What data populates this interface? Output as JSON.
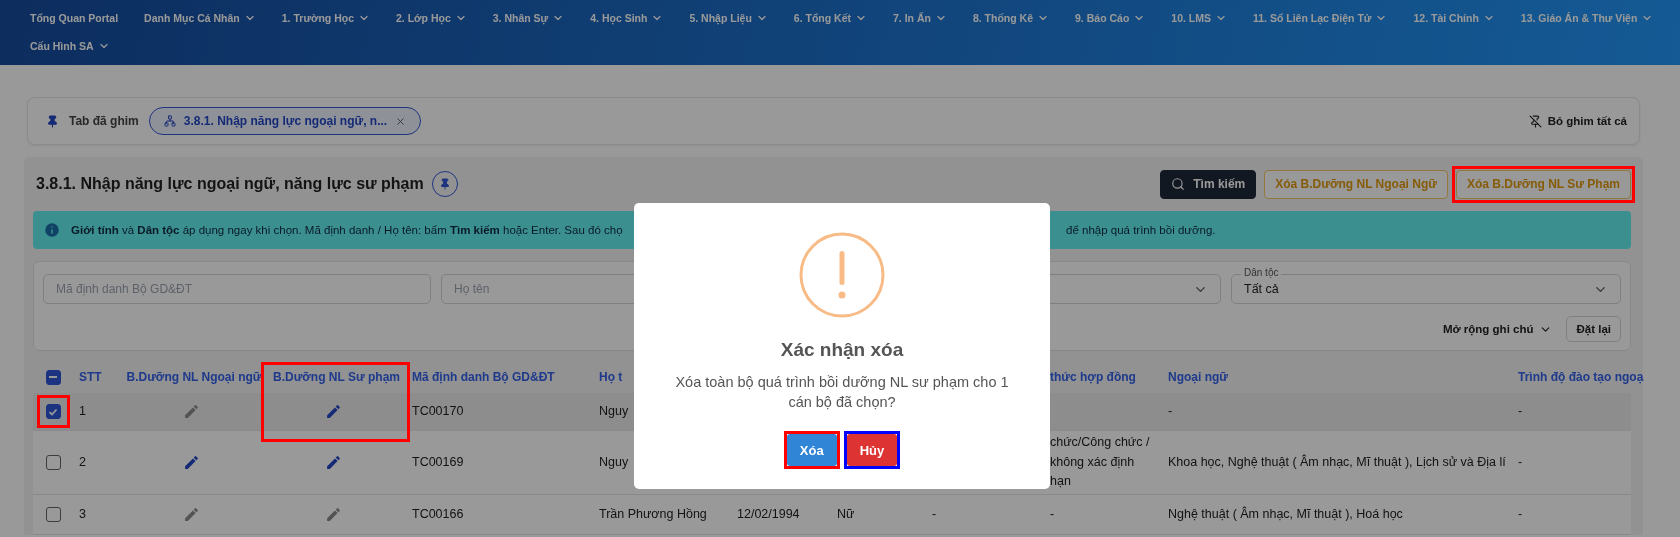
{
  "nav": {
    "items": [
      {
        "label": "Tổng Quan Portal",
        "has_menu": false
      },
      {
        "label": "Danh Mục Cá Nhân",
        "has_menu": true
      },
      {
        "label": "1. Trường Học",
        "has_menu": true
      },
      {
        "label": "2. Lớp Học",
        "has_menu": true
      },
      {
        "label": "3. Nhân Sự",
        "has_menu": true
      },
      {
        "label": "4. Học Sinh",
        "has_menu": true
      },
      {
        "label": "5. Nhập Liệu",
        "has_menu": true
      },
      {
        "label": "6. Tổng Kết",
        "has_menu": true
      },
      {
        "label": "7. In Ấn",
        "has_menu": true
      },
      {
        "label": "8. Thống Kê",
        "has_menu": true
      },
      {
        "label": "9. Báo Cáo",
        "has_menu": true
      },
      {
        "label": "10. LMS",
        "has_menu": true
      },
      {
        "label": "11. Sổ Liên Lạc Điện Tử",
        "has_menu": true
      },
      {
        "label": "12. Tài Chính",
        "has_menu": true
      },
      {
        "label": "13. Giáo Án & Thư Viện",
        "has_menu": true
      },
      {
        "label": "Cấu Hình SA",
        "has_menu": true
      }
    ]
  },
  "pinned_bar": {
    "label": "Tab đã ghim",
    "tabs": [
      {
        "label": "3.8.1. Nhập năng lực ngoại ngữ, n...",
        "selected": true
      }
    ],
    "unpin_all": "Bỏ ghim tất cả"
  },
  "page": {
    "title": "3.8.1. Nhập năng lực ngoại ngữ, năng lực sư phạm",
    "actions": [
      {
        "kind": "dark",
        "label": "Tìm kiếm",
        "highlighted": false
      },
      {
        "kind": "outline",
        "label": "Xóa B.Dưỡng NL Ngoại Ngữ",
        "highlighted": false
      },
      {
        "kind": "outline",
        "label": "Xóa B.Dưỡng NL Sư Phạm",
        "highlighted": true
      }
    ]
  },
  "info": {
    "text_left": "**Giới tính** và **Dân tộc** áp dụng ngay khi chọn. Mã định danh / Họ tên: bấm **Tìm kiếm** hoặc Enter. Sau đó chọ",
    "text_right": "để nhập quá trình bồi dưỡng."
  },
  "filters": {
    "fields": [
      {
        "kind": "input",
        "placeholder": "Mã định danh Bộ GD&ĐT"
      },
      {
        "kind": "input",
        "placeholder": "Họ tên"
      },
      {
        "kind": "select"
      },
      {
        "kind": "select",
        "label": "Dân tộc",
        "value": "Tất cả"
      }
    ],
    "expand": "Mở rộng ghi chú",
    "reset": "Đặt lại"
  },
  "table": {
    "select_all": {
      "indeterminate": true
    },
    "headers": {
      "stt": "STT",
      "edit_foreign": "B.Dưỡng NL Ngoại ngữ",
      "edit_pedagogy": "B.Dưỡng NL Sư phạm",
      "code": "Mã định danh Bộ GD&ĐT",
      "name": "Họ t",
      "contract": "thức hợp đồng",
      "language": "Ngoại ngữ",
      "training": "Trình độ đào tạo ngoạ"
    },
    "framed": {
      "edit_pedagogy": true
    },
    "rows": [
      {
        "selected": true,
        "checked": true,
        "highlighted": true,
        "stt": "1",
        "edit_foreign": {
          "active": false
        },
        "edit_pedagogy": {
          "active": true
        },
        "code": "TC00170",
        "name": "Nguy",
        "language": "-",
        "training": "-"
      },
      {
        "selected": false,
        "checked": false,
        "highlighted": false,
        "stt": "2",
        "edit_foreign": {
          "active": true
        },
        "edit_pedagogy": {
          "active": true
        },
        "code": "TC00169",
        "name": "Nguy",
        "contract": "chức/Công chức / không xác định hạn",
        "language": "Khoa học, Nghệ thuật ( Âm nhạc, Mĩ thuật ), Lịch sử và Địa lí",
        "training": "-"
      },
      {
        "selected": false,
        "checked": false,
        "highlighted": false,
        "stt": "3",
        "edit_foreign": {
          "active": false
        },
        "edit_pedagogy": {
          "active": false
        },
        "code": "TC00166",
        "name": "Trần Phương Hồng",
        "birth": "12/02/1994",
        "gender": "Nữ",
        "column_9": "-",
        "contract": "-",
        "language": "Nghệ thuật ( Âm nhạc, Mĩ thuật ), Hoá học",
        "training": "-"
      }
    ]
  },
  "modal": {
    "title": "Xác nhận xóa",
    "message": "Xóa toàn bộ quá trình bồi dưỡng NL sư phạm cho 1 cán bộ đã chọn?",
    "buttons": [
      {
        "kind": "confirm",
        "label": "Xóa",
        "framed": true
      },
      {
        "kind": "cancel",
        "label": "Hủy",
        "framed": true
      }
    ]
  }
}
